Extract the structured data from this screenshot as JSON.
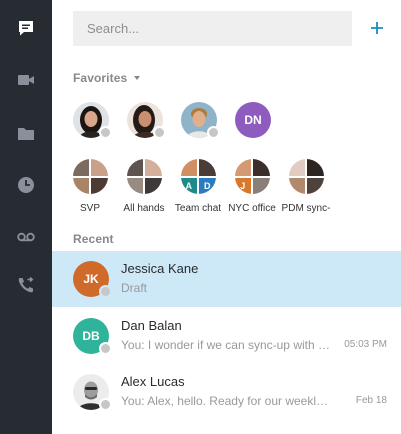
{
  "sidebar": {
    "items": [
      {
        "icon": "chat-icon",
        "active": true
      },
      {
        "icon": "video-camera-icon",
        "active": false
      },
      {
        "icon": "folder-icon",
        "active": false
      },
      {
        "icon": "clock-icon",
        "active": false
      },
      {
        "icon": "voicemail-icon",
        "active": false
      },
      {
        "icon": "phone-forward-icon",
        "active": false
      }
    ]
  },
  "search": {
    "placeholder": "Search..."
  },
  "add_button": {
    "icon": "plus-icon",
    "color": "#1a8bc9"
  },
  "favorites": {
    "title": "Favorites",
    "contacts": [
      {
        "type": "photo",
        "icon": "woman-photo-avatar"
      },
      {
        "type": "photo",
        "icon": "woman-photo-avatar"
      },
      {
        "type": "photo",
        "icon": "man-photo-avatar"
      },
      {
        "type": "initials",
        "initials": "DN",
        "color": "#8e5bbf"
      }
    ],
    "groups": [
      {
        "label": "SVP"
      },
      {
        "label": "All hands"
      },
      {
        "label": "Team chat",
        "initials": [
          "A",
          "D"
        ]
      },
      {
        "label": "NYC office",
        "initials": [
          "J"
        ]
      },
      {
        "label": "PDM sync-"
      }
    ]
  },
  "recent": {
    "title": "Recent",
    "conversations": [
      {
        "name": "Jessica Kane",
        "preview": "Draft",
        "time": "",
        "initials": "JK",
        "color": "#cf6a2b",
        "selected": true
      },
      {
        "name": "Dan Balan",
        "preview": "You: I wonder if we can sync-up with your team.",
        "time": "05:03 PM",
        "initials": "DB",
        "color": "#2fb39a",
        "selected": false
      },
      {
        "name": "Alex Lucas",
        "preview": "You: Alex, hello. Ready for our weekly sync?",
        "time": "Feb 18",
        "initials": "",
        "photo": true,
        "selected": false
      }
    ]
  },
  "colors": {
    "rail": "#272c33",
    "accent": "#1a8bc9",
    "selected_row": "#cde9f8",
    "status_offline": "#c7c7c7"
  }
}
